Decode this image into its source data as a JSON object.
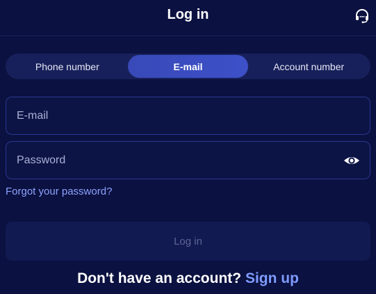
{
  "header": {
    "title": "Log in",
    "support_icon": "headset-icon"
  },
  "tabs": [
    {
      "label": "Phone number",
      "active": false
    },
    {
      "label": "E-mail",
      "active": true
    },
    {
      "label": "Account number",
      "active": false
    }
  ],
  "form": {
    "email_placeholder": "E-mail",
    "email_value": "",
    "password_placeholder": "Password",
    "password_value": "",
    "eye_icon": "eye-icon",
    "forgot_label": "Forgot your password?",
    "submit_label": "Log in"
  },
  "footer": {
    "prompt": "Don't have an account?",
    "signup_label": "Sign up"
  },
  "colors": {
    "background": "#0b1140",
    "active_tab": "#3d50c8",
    "link": "#8da2ff"
  }
}
